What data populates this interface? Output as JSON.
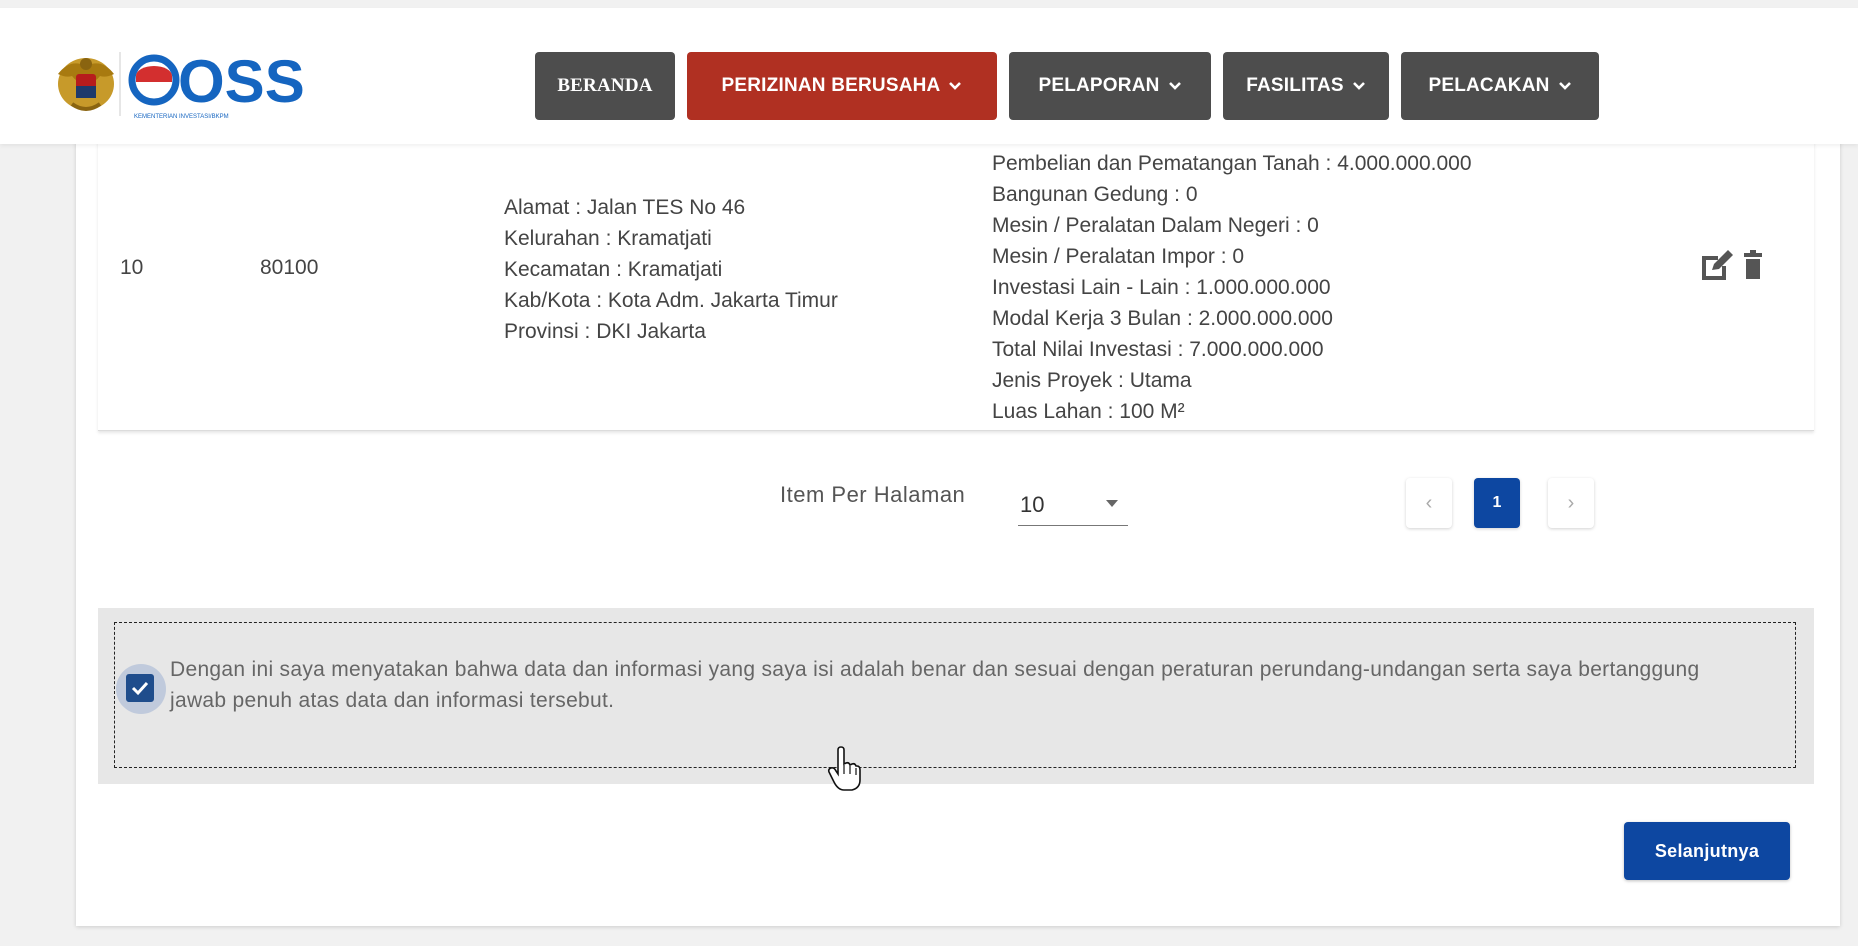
{
  "header": {
    "logo_text": "OSS",
    "logo_subtext": "KEMENTERIAN INVESTASI/BKPM",
    "nav": [
      {
        "label": "BERANDA",
        "dropdown": false,
        "active": false
      },
      {
        "label": "PERIZINAN BERUSAHA",
        "dropdown": true,
        "active": true
      },
      {
        "label": "PELAPORAN",
        "dropdown": true,
        "active": false
      },
      {
        "label": "FASILITAS",
        "dropdown": true,
        "active": false
      },
      {
        "label": "PELACAKAN",
        "dropdown": true,
        "active": false
      }
    ]
  },
  "row": {
    "no": "10",
    "kbli": "80100",
    "address": [
      "Alamat : Jalan TES No 46",
      "Kelurahan : Kramatjati",
      "Kecamatan : Kramatjati",
      "Kab/Kota : Kota Adm. Jakarta Timur",
      "Provinsi : DKI Jakarta"
    ],
    "investment": [
      "Pembelian dan Pematangan Tanah : 4.000.000.000",
      "Bangunan Gedung : 0",
      "Mesin / Peralatan Dalam Negeri : 0",
      "Mesin / Peralatan Impor : 0",
      "Investasi Lain - Lain : 1.000.000.000",
      "Modal Kerja 3 Bulan : 2.000.000.000",
      "Total Nilai Investasi : 7.000.000.000",
      "Jenis Proyek : Utama",
      "Luas Lahan : 100 M²"
    ]
  },
  "pagination": {
    "label": "Item Per Halaman",
    "per_page": "10",
    "prev": "‹",
    "current_page": "1",
    "next": "›"
  },
  "declaration": {
    "checked": true,
    "text": "Dengan ini saya menyatakan bahwa data dan informasi yang saya isi adalah benar dan sesuai dengan peraturan perundang-undangan serta saya bertanggung jawab penuh atas data dan informasi tersebut."
  },
  "next_button": "Selanjutnya",
  "colors": {
    "nav_default": "#4d4d4d",
    "nav_active": "#b03022",
    "primary": "#0d47a1",
    "logo_blue": "#1565c0",
    "logo_red": "#d32f2f"
  }
}
